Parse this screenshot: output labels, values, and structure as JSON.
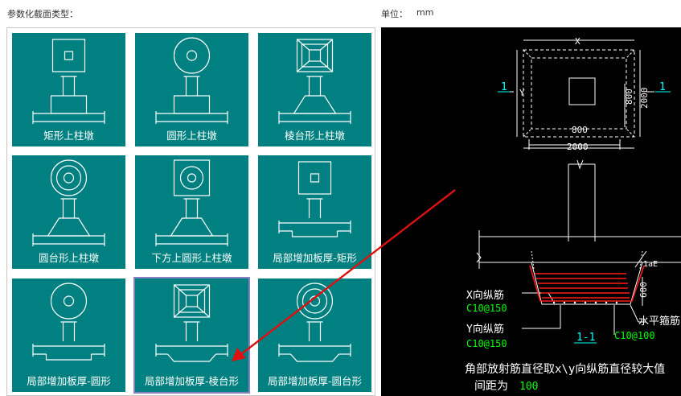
{
  "header": {
    "section_label": "参数化截面类型：",
    "unit_label": "单位：",
    "unit_value": "mm"
  },
  "grid": {
    "selected_index": 7,
    "items": [
      {
        "label": "矩形上柱墩",
        "top_shape": "square",
        "base_shape": "rect-pier"
      },
      {
        "label": "圆形上柱墩",
        "top_shape": "circle",
        "base_shape": "rect-pier"
      },
      {
        "label": "棱台形上柱墩",
        "top_shape": "frustum",
        "base_shape": "frustum-pier"
      },
      {
        "label": "圆台形上柱墩",
        "top_shape": "circle-double",
        "base_shape": "frustum-pier"
      },
      {
        "label": "下方上圆形上柱墩",
        "top_shape": "square-circle",
        "base_shape": "frustum-pier"
      },
      {
        "label": "局部增加板厚-矩形",
        "top_shape": "square",
        "base_shape": "slab-rect"
      },
      {
        "label": "局部增加板厚-圆形",
        "top_shape": "circle",
        "base_shape": "slab-rect"
      },
      {
        "label": "局部增加板厚-棱台形",
        "top_shape": "frustum",
        "base_shape": "slab-trap"
      },
      {
        "label": "局部增加板厚-圆台形",
        "top_shape": "circle-double",
        "base_shape": "slab-trap"
      }
    ]
  },
  "preview": {
    "dims": {
      "x_label": "X",
      "y_label": "Y",
      "inner_w": "800",
      "outer_w": "2000",
      "inner_h": "800",
      "outer_h": "2000"
    },
    "section_marks": [
      "1",
      "1"
    ],
    "section_name": "1-1",
    "dim_600": "600",
    "dim_lae": "1aE",
    "x_bar_label": "X向纵筋",
    "x_bar_value": "C10@150",
    "y_bar_label": "Y向纵筋",
    "y_bar_value": "C10@150",
    "stirrup_label": "水平箍筋",
    "stirrup_value": "C10@100",
    "note_line1": "角部放射筋直径取x\\y向纵筋直径较大值",
    "note_line2_prefix": "间距为",
    "note_line2_value": "100"
  },
  "colors": {
    "cell_bg": "#008080",
    "cad_bg": "#000000",
    "cad_line": "#ffffff",
    "cad_green": "#00ff00",
    "cad_cyan": "#00ffff",
    "cad_red": "#ff0000",
    "arrow": "#dd1111"
  }
}
